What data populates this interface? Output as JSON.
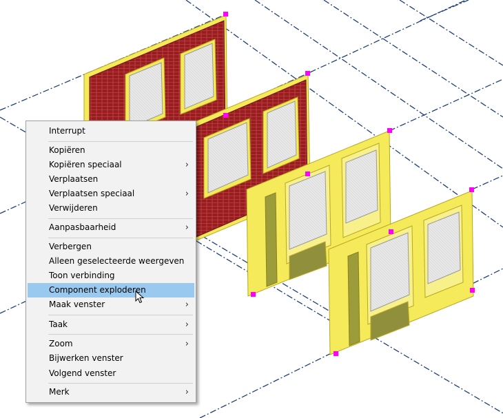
{
  "viewport": {
    "wall_color": "#9b1c1f",
    "frame_color": "#f5ea5a",
    "grip_color": "#ff00ff",
    "gridline_color": "#1f3f7a"
  },
  "context_menu": {
    "highlight_color": "#99c9ef",
    "items": [
      {
        "label": "Interrupt",
        "submenu": false
      },
      {
        "label": "Kopiëren",
        "submenu": false
      },
      {
        "label": "Kopiëren speciaal",
        "submenu": true
      },
      {
        "label": "Verplaatsen",
        "submenu": false
      },
      {
        "label": "Verplaatsen speciaal",
        "submenu": true
      },
      {
        "label": "Verwijderen",
        "submenu": false
      },
      {
        "label": "Aanpasbaarheid",
        "submenu": true
      },
      {
        "label": "Verbergen",
        "submenu": false
      },
      {
        "label": "Alleen geselecteerde weergeven",
        "submenu": false
      },
      {
        "label": "Toon verbinding",
        "submenu": false
      },
      {
        "label": "Component exploderen",
        "submenu": false,
        "highlighted": true
      },
      {
        "label": "Maak venster",
        "submenu": true
      },
      {
        "label": "Taak",
        "submenu": true
      },
      {
        "label": "Zoom",
        "submenu": true
      },
      {
        "label": "Bijwerken venster",
        "submenu": false
      },
      {
        "label": "Volgend venster",
        "submenu": false
      },
      {
        "label": "Merk",
        "submenu": true
      }
    ],
    "submenu_arrow": "›"
  }
}
